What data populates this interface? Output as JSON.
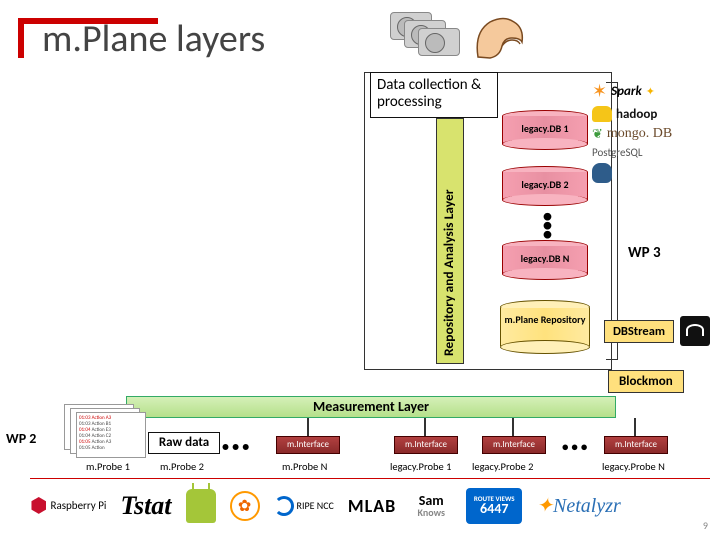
{
  "title": "m.Plane layers",
  "data_collection": {
    "label": "Data collection & processing"
  },
  "ral_label": "Repository and Analysis Layer",
  "legacy_dbs": [
    "legacy.DB 1",
    "legacy.DB 2",
    "legacy.DB N"
  ],
  "mplane_repo": "m.Plane Repository",
  "wp3": "WP 3",
  "logos": {
    "spark": "Spark",
    "hadoop": "hadoop",
    "mongo": "mongo. DB",
    "postgres": "PostgreSQL"
  },
  "tags": {
    "dbstream": "DBStream",
    "blockmon": "Blockmon"
  },
  "measurement_layer": "Measurement Layer",
  "wp2": "WP 2",
  "rawdata": "Raw data",
  "term_lines": [
    "01:03 Action A3",
    "01:03 Action B1",
    "01:04 Action E3",
    "01:04 Action C2",
    "01:05 Action A3",
    "01:05 Action"
  ],
  "minterface": "m.Interface",
  "probes": {
    "mprobe1": "m.Probe 1",
    "mprobe2": "m.Probe 2",
    "mprobeN": "m.Probe N",
    "lprobe1": "legacy.Probe 1",
    "lprobe2": "legacy.Probe 2",
    "lprobeN": "legacy.Probe N"
  },
  "bottom_logos": {
    "raspberrypi": "Raspberry Pi",
    "tstat": "Tstat",
    "ripe": "RIPE NCC",
    "mlab": "MLAB",
    "samknows": "Sam Knows",
    "routeviews": "ROUTE VIEWS",
    "routeviews_num": "6447",
    "netalyzr": "Netalyzr"
  },
  "page_num": "9"
}
